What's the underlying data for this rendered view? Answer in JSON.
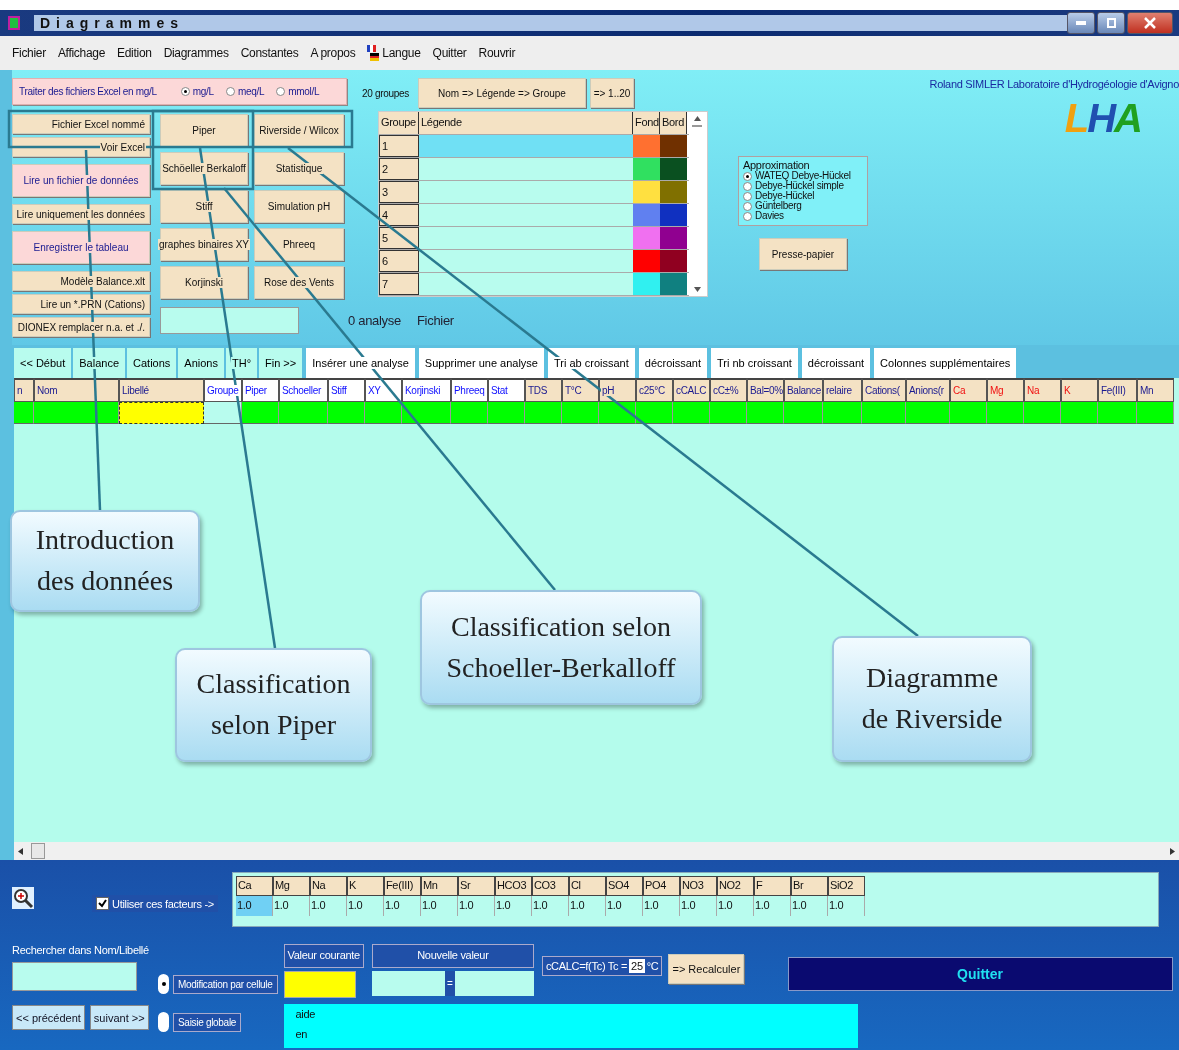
{
  "window": {
    "title": "Diagrammes"
  },
  "menu": [
    {
      "label": "Fichier",
      "kind": "text"
    },
    {
      "label": "Affichage",
      "kind": "text"
    },
    {
      "label": "Edition",
      "kind": "text"
    },
    {
      "label": "Diagrammes",
      "kind": "text"
    },
    {
      "label": "Constantes",
      "kind": "text"
    },
    {
      "label": "A propos",
      "kind": "text"
    },
    {
      "label": "Langue",
      "kind": "flag"
    },
    {
      "label": "Quitter",
      "kind": "text"
    },
    {
      "label": "Rouvrir",
      "kind": "text"
    }
  ],
  "excel_units": {
    "label": "Traiter des fichiers Excel en mg/L",
    "options": [
      {
        "label": "mg/L",
        "selected": true
      },
      {
        "label": "meq/L",
        "selected": false
      },
      {
        "label": "mmol/L",
        "selected": false
      }
    ]
  },
  "file_buttons": [
    {
      "label": "Fichier Excel nommé",
      "kind": "plain"
    },
    {
      "label": "Voir Excel",
      "kind": "plain"
    },
    {
      "label": "Lire un fichier de données",
      "kind": "accent"
    },
    {
      "label": "Lire uniquement les données",
      "kind": "plain"
    },
    {
      "label": "Enregistrer le tableau",
      "kind": "accent"
    },
    {
      "label": "Modèle Balance.xlt",
      "kind": "plain"
    },
    {
      "label": "Lire un *.PRN (Cations)",
      "kind": "plain"
    },
    {
      "label": "DIONEX remplacer n.a. et ./.",
      "kind": "plain"
    }
  ],
  "diagram_buttons": [
    {
      "label": "Piper"
    },
    {
      "label": "Riverside / Wilcox"
    },
    {
      "label": "Schöeller Berkaloff"
    },
    {
      "label": "Statistique"
    },
    {
      "label": "Stiff"
    },
    {
      "label": "Simulation pH"
    },
    {
      "label": "graphes binaires XY"
    },
    {
      "label": "Phreeq"
    },
    {
      "label": "Korjinski"
    },
    {
      "label": "Rose des Vents"
    }
  ],
  "analysis_count": "0 analyse",
  "file_label": "Fichier",
  "groups": {
    "count_label": "20 groupes",
    "buttons": [
      "Nom => Légende => Groupe",
      "=> 1..20"
    ],
    "columns": [
      "Groupe",
      "Légende",
      "Fond",
      "Bord"
    ],
    "rows": [
      {
        "group": "1",
        "selected": true,
        "swatches": [
          {
            "color": "#ff7030"
          },
          {
            "color": "#703000"
          }
        ]
      },
      {
        "group": "2",
        "selected": false,
        "swatches": [
          {
            "color": "#30e060"
          },
          {
            "color": "#0a5020"
          }
        ]
      },
      {
        "group": "3",
        "selected": false,
        "swatches": [
          {
            "color": "#ffe040"
          },
          {
            "color": "#807000"
          }
        ]
      },
      {
        "group": "4",
        "selected": false,
        "swatches": [
          {
            "color": "#6080f0"
          },
          {
            "color": "#1030c0"
          }
        ]
      },
      {
        "group": "5",
        "selected": false,
        "swatches": [
          {
            "color": "#f070f0"
          },
          {
            "color": "#900090"
          }
        ]
      },
      {
        "group": "6",
        "selected": false,
        "swatches": [
          {
            "color": "#ff0000"
          },
          {
            "color": "#900020"
          }
        ]
      },
      {
        "group": "7",
        "selected": false,
        "swatches": [
          {
            "color": "#30f0f0"
          },
          {
            "color": "#108080"
          }
        ]
      }
    ]
  },
  "approximation": {
    "title": "Approximation",
    "options": [
      {
        "label": "WATEQ Debye-Hückel",
        "selected": true
      },
      {
        "label": "Debye-Hückel simple",
        "selected": false
      },
      {
        "label": "Debye-Hückel",
        "selected": false
      },
      {
        "label": "Güntelberg",
        "selected": false
      },
      {
        "label": "Davies",
        "selected": false
      }
    ]
  },
  "clipboard_button": "Presse-papier",
  "credit": "Roland SIMLER Laboratoire d'Hydrogéologie d'Avigno",
  "logo": [
    {
      "char": "L",
      "color": "#f0a010"
    },
    {
      "char": "H",
      "color": "#2050b0"
    },
    {
      "char": "A",
      "color": "#20a020"
    }
  ],
  "nav_buttons": [
    "<< Début",
    "Balance",
    "Cations",
    "Anions",
    "TH°",
    "Fin >>"
  ],
  "action_buttons": [
    "Insérer une analyse",
    "Supprimer une analyse",
    "Tri ab croissant",
    "décroissant",
    "Tri nb croissant",
    "décroissant",
    "Colonnes supplémentaires"
  ],
  "table": {
    "columns": [
      {
        "label": "n",
        "kind": "index",
        "selected": false
      },
      {
        "label": "Nom",
        "kind": "text",
        "selected": false
      },
      {
        "label": "Libellé",
        "kind": "text",
        "selected": true
      },
      {
        "label": "Groupe",
        "kind": "group",
        "selected": false
      },
      {
        "label": "Piper",
        "kind": "link",
        "selected": false
      },
      {
        "label": "Schoeller",
        "kind": "link",
        "selected": false
      },
      {
        "label": "Stiff",
        "kind": "link",
        "selected": false
      },
      {
        "label": "XY",
        "kind": "link",
        "selected": false
      },
      {
        "label": "Korjinski",
        "kind": "link",
        "selected": false
      },
      {
        "label": "Phreeq",
        "kind": "link",
        "selected": false
      },
      {
        "label": "Stat",
        "kind": "link",
        "selected": false
      },
      {
        "label": "TDS",
        "kind": "value",
        "selected": false
      },
      {
        "label": "T°C",
        "kind": "value",
        "selected": false
      },
      {
        "label": "pH",
        "kind": "value",
        "selected": false
      },
      {
        "label": "c25°C",
        "kind": "value",
        "selected": false
      },
      {
        "label": "cCALC",
        "kind": "value",
        "selected": false
      },
      {
        "label": "cC±%",
        "kind": "value",
        "selected": false
      },
      {
        "label": "Bal=0%",
        "kind": "value",
        "selected": false
      },
      {
        "label": "Balance",
        "kind": "value",
        "selected": false
      },
      {
        "label": "relaire",
        "kind": "value",
        "selected": false
      },
      {
        "label": "Cations(",
        "kind": "value",
        "selected": false
      },
      {
        "label": "Anions(r",
        "kind": "value",
        "selected": false
      },
      {
        "label": "Ca",
        "kind": "ion",
        "selected": false
      },
      {
        "label": "Mg",
        "kind": "ion",
        "selected": false
      },
      {
        "label": "Na",
        "kind": "ion",
        "selected": false
      },
      {
        "label": "K",
        "kind": "ion",
        "selected": false
      },
      {
        "label": "Fe(III)",
        "kind": "value",
        "selected": false
      },
      {
        "label": "Mn",
        "kind": "value",
        "selected": false
      }
    ]
  },
  "annotations": [
    {
      "lines": [
        "Introduction",
        "des données"
      ]
    },
    {
      "lines": [
        "Classification",
        "selon Piper"
      ]
    },
    {
      "lines": [
        "Classification  selon",
        "Schoeller-Berkalloff"
      ]
    },
    {
      "lines": [
        "Diagramme",
        "de Riverside"
      ]
    }
  ],
  "factors": {
    "checkbox": {
      "label": "Utiliser ces facteurs ->",
      "checked": true
    },
    "items": [
      {
        "ion": "Ca",
        "value": "1.0",
        "selected": true
      },
      {
        "ion": "Mg",
        "value": "1.0",
        "selected": false
      },
      {
        "ion": "Na",
        "value": "1.0",
        "selected": false
      },
      {
        "ion": "K",
        "value": "1.0",
        "selected": false
      },
      {
        "ion": "Fe(III)",
        "value": "1.0",
        "selected": false
      },
      {
        "ion": "Mn",
        "value": "1.0",
        "selected": false
      },
      {
        "ion": "Sr",
        "value": "1.0",
        "selected": false
      },
      {
        "ion": "HCO3",
        "value": "1.0",
        "selected": false
      },
      {
        "ion": "CO3",
        "value": "1.0",
        "selected": false
      },
      {
        "ion": "Cl",
        "value": "1.0",
        "selected": false
      },
      {
        "ion": "SO4",
        "value": "1.0",
        "selected": false
      },
      {
        "ion": "PO4",
        "value": "1.0",
        "selected": false
      },
      {
        "ion": "NO3",
        "value": "1.0",
        "selected": false
      },
      {
        "ion": "NO2",
        "value": "1.0",
        "selected": false
      },
      {
        "ion": "F",
        "value": "1.0",
        "selected": false
      },
      {
        "ion": "Br",
        "value": "1.0",
        "selected": false
      },
      {
        "ion": "SiO2",
        "value": "1.0",
        "selected": false
      }
    ]
  },
  "search": {
    "label": "Rechercher dans Nom/Libellé",
    "buttons": [
      "<< précédent",
      "suivant >>"
    ]
  },
  "edit_modes": [
    {
      "label": "Modification par cellule",
      "selected": true
    },
    {
      "label": "Saisie globale",
      "selected": false
    }
  ],
  "current_value": {
    "label": "Valeur courante"
  },
  "new_value": {
    "label": "Nouvelle valeur",
    "button": "="
  },
  "temperature": {
    "label": "cCALC=f(Tc)  Tc =",
    "value": "25",
    "unit": "°C"
  },
  "recalc_button": "=> Recalculer",
  "quit_button": "Quitter",
  "help": [
    "aide",
    "en"
  ]
}
